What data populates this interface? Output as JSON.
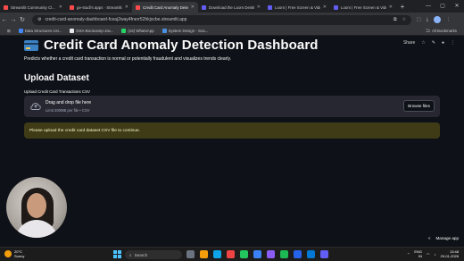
{
  "browser": {
    "tabs": [
      {
        "title": "Streamlit Community Cl...",
        "fav": "#ff4b4b",
        "active": false
      },
      {
        "title": "ge-studi's apps · Streamlit",
        "fav": "#ff4b4b",
        "active": false
      },
      {
        "title": "Credit Card Anomaly Dete",
        "fav": "#ff4b4b",
        "active": true
      },
      {
        "title": "Download the Loom Deskt",
        "fav": "#625df5",
        "active": false
      },
      {
        "title": "Loom | Free Screen & Vide",
        "fav": "#625df5",
        "active": false
      },
      {
        "title": "Loom | Free Screen & Vide",
        "fav": "#625df5",
        "active": false
      }
    ],
    "url": "credit-card-anomaly-dashboard-fceaj2way4fnerr52hkjxcbe.streamlit.app",
    "bookmarks": [
      {
        "label": "Data Structures Usi...",
        "fav": "#4285f4"
      },
      {
        "label": "DSA-Bootcamp-Jav...",
        "fav": "#e8e8e8"
      },
      {
        "label": "(16) WhatsApp",
        "fav": "#25d366"
      },
      {
        "label": "System Design - Sca...",
        "fav": "#4a90e2"
      }
    ],
    "all_bookmarks": "All Bookmarks",
    "new_tab": "+",
    "win_min": "—",
    "win_max": "▢",
    "win_close": "✕"
  },
  "app": {
    "share_label": "Share",
    "title": "Credit Card Anomaly Detection Dashboard",
    "subtitle": "Predicts whether a credit card transaction is normal or potentially fraudulent and visualizes trends clearly.",
    "section_title": "Upload Dataset",
    "uploader_label": "Upload Credit Card Transactions CSV",
    "dropzone_main": "Drag and drop file here",
    "dropzone_sub": "Limit 200MB per file • CSV",
    "browse_label": "Browse files",
    "alert_text": "Please upload the credit card dataset CSV file to continue.",
    "manage_app": "Manage app",
    "manage_chevron": "<"
  },
  "taskbar": {
    "temp": "20°C",
    "weather": "Sunny",
    "search_placeholder": "Search",
    "lang": "ENG",
    "region": "IN",
    "time": "13:48",
    "date": "29-01-2026"
  },
  "colors": {
    "app_bg": "#0e1117",
    "alert_bg": "#3e3b16",
    "accent": "#ff4b4b"
  }
}
